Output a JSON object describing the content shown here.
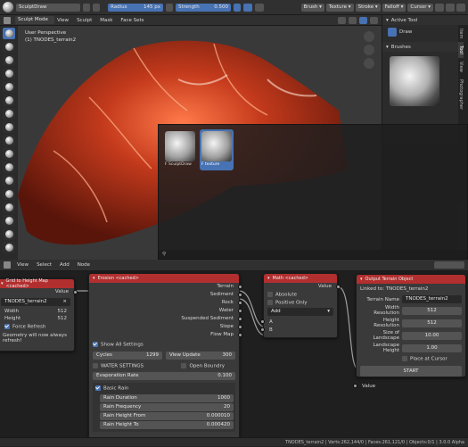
{
  "topbar": {
    "brush_name": "SculptDraw",
    "radius_label": "Radius",
    "radius_value": "145 px",
    "strength_label": "Strength",
    "strength_value": "0.500",
    "menus": [
      "Brush",
      "Texture",
      "Stroke",
      "Falloff",
      "Cursor"
    ]
  },
  "viewport_header": {
    "mode": "Sculpt Mode",
    "menus": [
      "View",
      "Sculpt",
      "Mask",
      "Face Sets"
    ]
  },
  "viewport": {
    "perspective": "User Perspective",
    "object": "(1) TNODES_terrain2"
  },
  "properties": {
    "active_tool_title": "Active Tool",
    "active_tool_name": "Draw",
    "brushes_title": "Brushes",
    "side_tabs": [
      "Item",
      "Tool",
      "View",
      "Photographer"
    ]
  },
  "brush_popup": {
    "items": [
      {
        "label": "F SculptDraw",
        "selected": false
      },
      {
        "label": "F texture",
        "selected": true
      }
    ]
  },
  "node_editor_header": {
    "menus": [
      "View",
      "Select",
      "Add",
      "Node"
    ]
  },
  "nodes": {
    "grid": {
      "title": "Grid to Height Map <cached>",
      "output": "Value",
      "object": "TNODES_terrain2",
      "width_label": "Width",
      "width_value": "512",
      "height_label": "Height",
      "height_value": "512",
      "force_refresh": "Force Refresh",
      "note": "Geometry will now always refresh!"
    },
    "erosion": {
      "title": "Erosion <cached>",
      "outputs": [
        "Terrain",
        "Sediment",
        "Rock",
        "Water",
        "Suspended Sediment",
        "Slope",
        "Flow Map"
      ],
      "show_all": "Show All Settings",
      "cycles_label": "Cycles",
      "cycles_value": "1299",
      "view_update_label": "View Update",
      "view_update_value": "300",
      "water_settings": "WATER SETTINGS",
      "open_boundary": "Open Boundry",
      "evaporation_label": "Evaporation Rate",
      "evaporation_value": "0.100",
      "basic_rain": "Basic Rain",
      "rain_duration_label": "Rain Duration",
      "rain_duration_value": "1000",
      "rain_frequency_label": "Rain Frequency",
      "rain_frequency_value": "20",
      "rain_height_from_label": "Rain Height From",
      "rain_height_from_value": "0.000010",
      "rain_height_to_label": "Rain Height To",
      "rain_height_to_value": "0.000420"
    },
    "math": {
      "title": "Math <cached>",
      "output": "Value",
      "absolute": "Absolute",
      "positive_only": "Positive Only",
      "operation": "Add",
      "inputs": [
        "A",
        "B"
      ]
    },
    "output": {
      "title": "Output Terrain Object",
      "linked": "Linked to: TNODES_terrain2",
      "terrain_name_label": "Terrain Name",
      "terrain_name_value": "TNODES_terrain2",
      "width_res_label": "Width Resolution",
      "width_res_value": "512",
      "height_res_label": "Height Resolution",
      "height_res_value": "512",
      "size_label": "Size of Landscape",
      "size_value": "10.00",
      "landscape_height_label": "Landscape Height",
      "landscape_height_value": "1.00",
      "place_cursor": "Place at Cursor",
      "start": "START",
      "input": "Value"
    }
  },
  "status_bar": "TNODES_terrain2 | Verts:262,144/0 | Faces:261,121/0 | Objects:0/1 | 3.0.0 Alpha",
  "colors": {
    "accent": "#4772b3",
    "node_header": "#b22f2f",
    "terrain": "#c43a1c"
  }
}
